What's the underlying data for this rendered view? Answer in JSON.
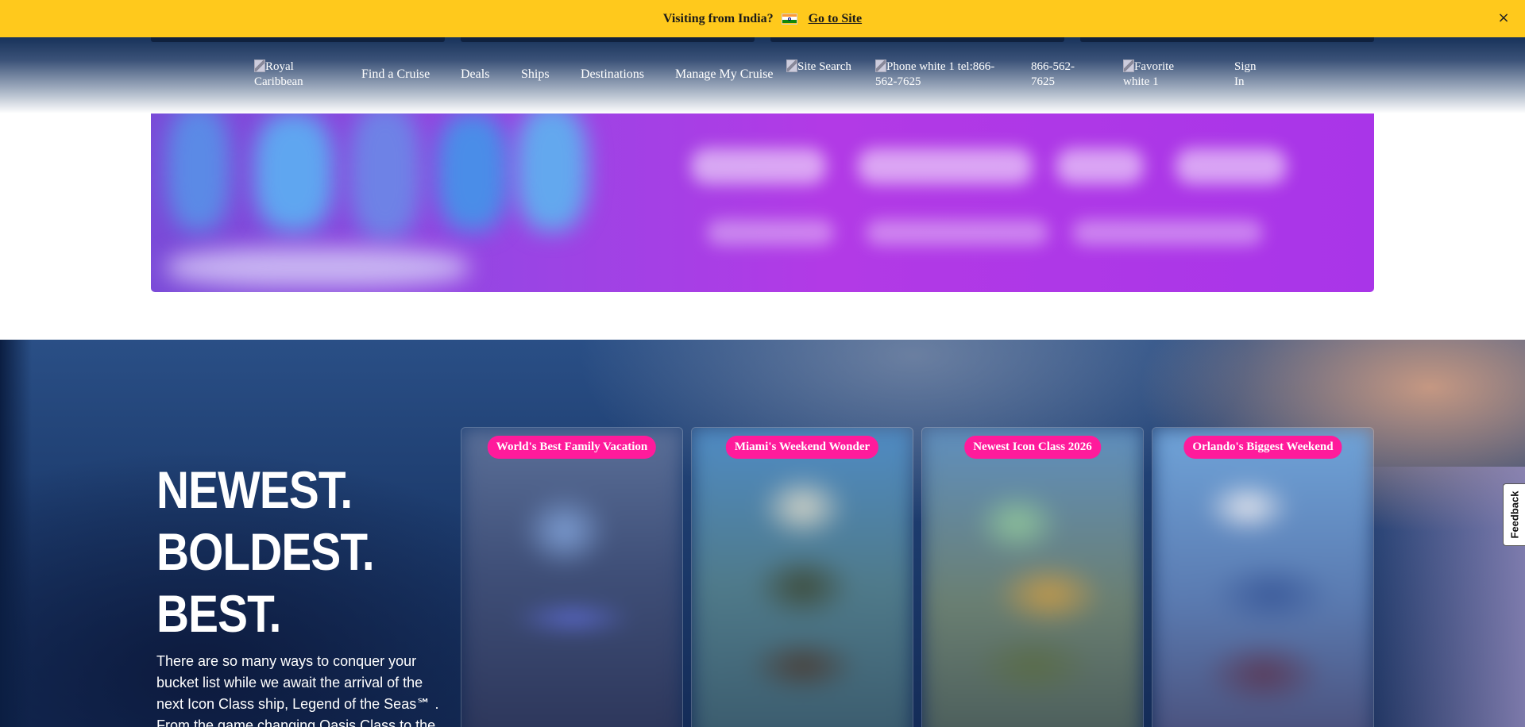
{
  "banner": {
    "message": "Visiting from India?",
    "flag_icon": "india-flag-icon",
    "link_label": "Go to Site",
    "close_glyph": "×",
    "bg_color": "#ffc91c"
  },
  "nav": {
    "logo_alt": "Royal Caribbean",
    "items": [
      "Find a Cruise",
      "Deals",
      "Ships",
      "Destinations",
      "Manage My Cruise"
    ],
    "search_alt": "Site Search",
    "phone_alt": "Phone white 1 tel:866-562-7625",
    "phone_number": "866-562-7625",
    "favorite_alt": "Favorite white 1",
    "sign_in": "Sign In"
  },
  "hero": {
    "headline": [
      "NEWEST.",
      "BOLDEST.",
      "BEST."
    ],
    "body": "There are so many ways to conquer your bucket list while we await the arrival of the next Icon Class ship, Legend of the Seas℠ . From the game changing Oasis Class to the",
    "cards": [
      {
        "tag": "World's Best Family Vacation"
      },
      {
        "tag": "Miami's Weekend Wonder"
      },
      {
        "tag": "Newest Icon Class 2026"
      },
      {
        "tag": "Orlando's Biggest Weekend"
      }
    ],
    "tag_color": "#ff1b9b"
  },
  "feedback": {
    "label": "Feedback"
  }
}
